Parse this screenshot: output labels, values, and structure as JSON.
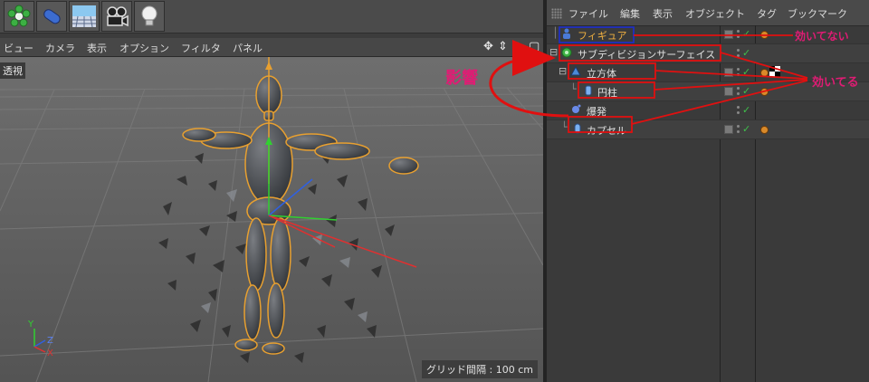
{
  "toolbar": {
    "buttons": [
      {
        "icon": "green-flower-icon",
        "label": ""
      },
      {
        "icon": "blue-capsule-icon",
        "label": ""
      },
      {
        "icon": "floor-grid-icon",
        "label": ""
      },
      {
        "icon": "camera-icon",
        "label": ""
      },
      {
        "icon": "light-bulb-icon",
        "label": ""
      }
    ]
  },
  "viewport": {
    "menu": [
      "ビュー",
      "カメラ",
      "表示",
      "オプション",
      "フィルタ",
      "パネル"
    ],
    "view_label": "透視",
    "grid_status": "グリッド間隔 : 100 cm",
    "axis_labels": {
      "x": "X",
      "y": "Y",
      "z": "Z"
    }
  },
  "object_manager": {
    "menu": [
      "ファイル",
      "編集",
      "表示",
      "オブジェクト",
      "タグ",
      "ブックマーク"
    ],
    "objects": [
      {
        "name": "フィギュア",
        "icon": "figure-icon",
        "tags": "material"
      },
      {
        "name": "サブディビジョンサーフェイス",
        "icon": "subdivision-surface-icon",
        "tags": ""
      },
      {
        "name": "立方体",
        "icon": "cube-icon",
        "tags": "material-checker"
      },
      {
        "name": "円柱",
        "icon": "cylinder-icon",
        "tags": "material"
      },
      {
        "name": "爆発",
        "icon": "explosion-icon",
        "tags": ""
      },
      {
        "name": "カプセル",
        "icon": "capsule-icon",
        "tags": "material"
      }
    ]
  },
  "annotations": {
    "influence": "影響",
    "not_working": "効いてない",
    "working": "効いてる"
  },
  "colors": {
    "annotation_red": "#e01010",
    "annotation_pink": "#e01c74",
    "figure_highlight": "#e8a030",
    "axis_x": "#e03030",
    "axis_y": "#30d030",
    "axis_z": "#3060e0"
  }
}
